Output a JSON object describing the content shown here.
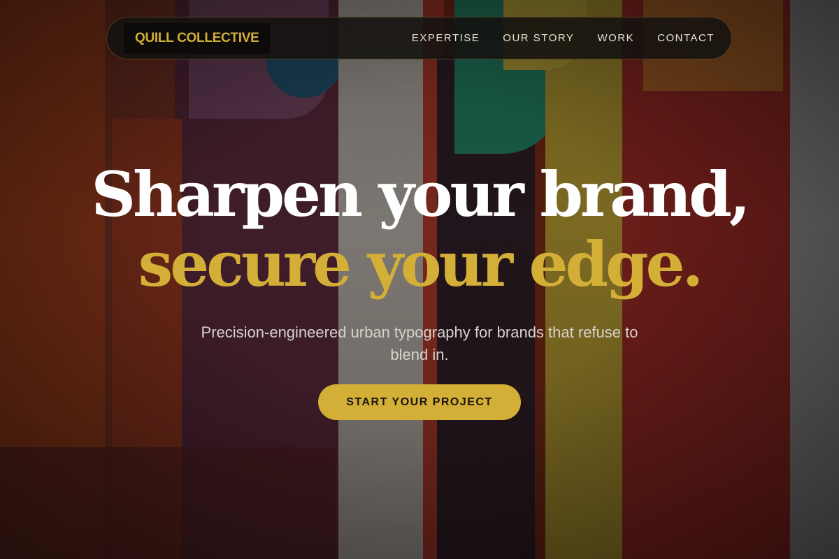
{
  "brand": {
    "name": "QUILL COLLECTIVE",
    "accent_color": "#d4af37"
  },
  "nav": {
    "items": [
      {
        "label": "EXPERTISE"
      },
      {
        "label": "OUR STORY"
      },
      {
        "label": "WORK"
      },
      {
        "label": "CONTACT"
      }
    ]
  },
  "hero": {
    "headline_line1": "Sharpen your brand,",
    "headline_line2": "secure your edge.",
    "subtitle": "Precision-engineered urban typography for brands that refuse to blend in.",
    "cta_label": "START YOUR PROJECT",
    "background_image": "abstract painted mural"
  }
}
